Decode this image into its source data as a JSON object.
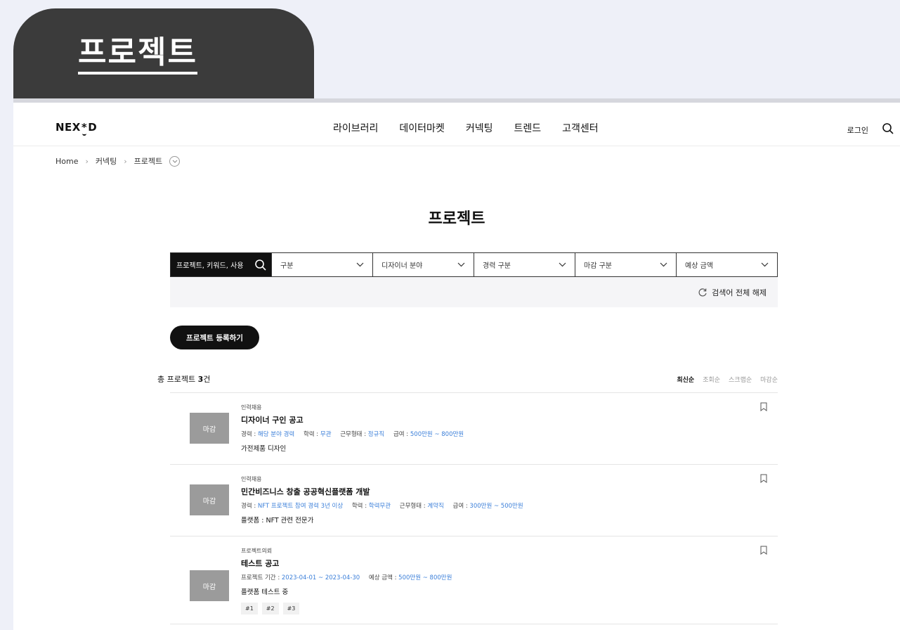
{
  "heading": "프로젝트",
  "logo": {
    "left": "NEX",
    "star": "*",
    "right": "D"
  },
  "nav": [
    "라이브러리",
    "데이터마켓",
    "커넥팅",
    "트렌드",
    "고객센터"
  ],
  "login": "로그인",
  "breadcrumb": [
    "Home",
    "커넥팅",
    "프로젝트"
  ],
  "page_title": "프로젝트",
  "filters": {
    "search_placeholder": "프로젝트, 키워드, 사용",
    "selects": [
      "구분",
      "디자이너 분야",
      "경력 구분",
      "마감 구분",
      "예상 금액"
    ]
  },
  "reset_label": "검색어 전체 해제",
  "register_button": "프로젝트 등록하기",
  "total": {
    "prefix": "총 프로젝트 ",
    "count": "3",
    "suffix": "건"
  },
  "sort": [
    "최신순",
    "조회순",
    "스크랩순",
    "마감순"
  ],
  "items": [
    {
      "status": "마감",
      "category": "인력채용",
      "title": "디자이너 구인 공고",
      "meta": [
        {
          "k": "경력 : ",
          "v": "해당 분야 경력"
        },
        {
          "k": "학력 : ",
          "v": "무관"
        },
        {
          "k": "근무형태 : ",
          "v": "정규직"
        },
        {
          "k": "급여 : ",
          "v": "500만원 ~ 800만원"
        }
      ],
      "desc": "가전제품 디자인"
    },
    {
      "status": "마감",
      "category": "인력채용",
      "title": "민간비즈니스 창출 공공혁신플랫폼 개발",
      "meta": [
        {
          "k": "경력 : ",
          "v": "NFT 프로젝트 참여 경력 3년 이상"
        },
        {
          "k": "학력 : ",
          "v": "학력무관"
        },
        {
          "k": "근무형태 : ",
          "v": "계약직"
        },
        {
          "k": "급여 : ",
          "v": "300만원 ~ 500만원"
        }
      ],
      "desc": "플랫폼 : NFT 관련 전문가"
    },
    {
      "status": "마감",
      "category": "프로젝트의뢰",
      "title": "테스트 공고",
      "meta": [
        {
          "k": "프로젝트 기간 : ",
          "v": "2023-04-01 ~ 2023-04-30"
        },
        {
          "k": "예상 금액 : ",
          "v": "500만원 ~ 800만원"
        }
      ],
      "desc": "플랫폼 테스트 중",
      "tags": [
        "#1",
        "#2",
        "#3"
      ]
    }
  ]
}
